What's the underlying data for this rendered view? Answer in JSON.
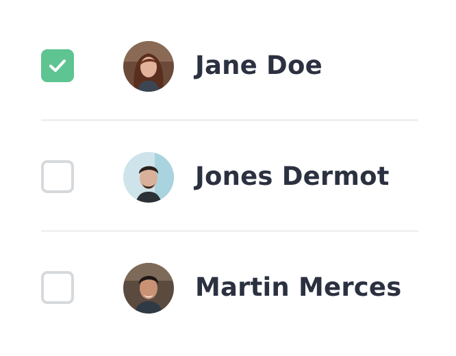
{
  "accent_color": "#5ec491",
  "people": [
    {
      "name": "Jane Doe",
      "checked": true
    },
    {
      "name": "Jones Dermot",
      "checked": false
    },
    {
      "name": "Martin Merces",
      "checked": false
    }
  ]
}
